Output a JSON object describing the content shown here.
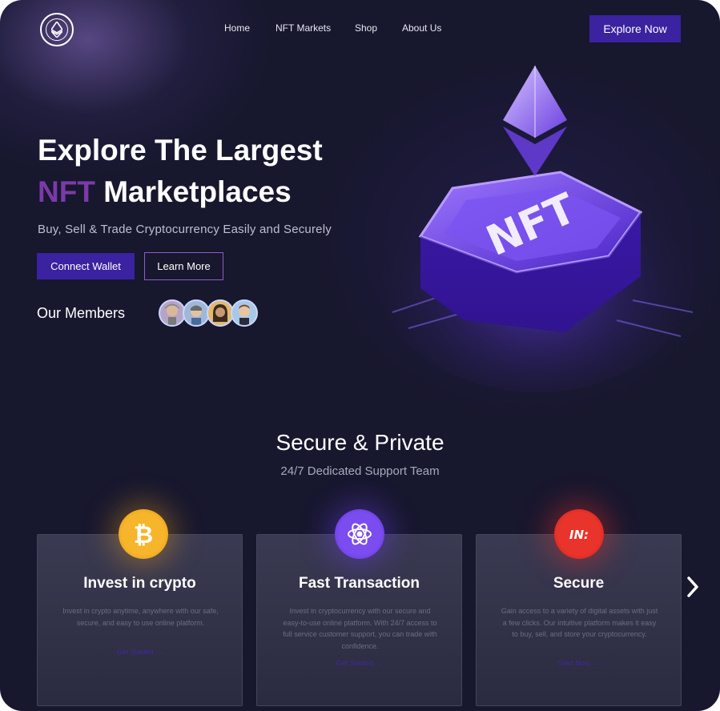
{
  "nav": {
    "logo_icon": "ethereum-icon",
    "links": [
      "Home",
      "NFT Markets",
      "Shop",
      "About Us"
    ],
    "cta": "Explore Now"
  },
  "hero": {
    "title_line1": "Explore The Largest",
    "title_accent": "NFT",
    "title_line2_rest": "Marketplaces",
    "subtitle": "Buy, Sell & Trade Cryptocurrency Easily and Securely",
    "connect_wallet": "Connect Wallet",
    "learn_more": "Learn More",
    "members_label": "Our Members",
    "art_text": "NFT"
  },
  "features": {
    "title": "Secure & Private",
    "subtitle": "24/7 Dedicated Support Team",
    "cards": [
      {
        "title": "Invest in crypto",
        "text": "Invest in crypto anytime, anywhere with our safe, secure, and easy to use online platform.",
        "link": "Get Started",
        "icon": "bitcoin-icon",
        "color": "#f2a21c"
      },
      {
        "title": "Fast Transaction",
        "text": "Invest in cryptocurrency with our secure and easy-to-use online platform. With 24/7 access to full service customer support, you can trade with confidence.",
        "link": "Get Started",
        "icon": "atom-icon",
        "color": "#6a3ee0"
      },
      {
        "title": "Secure",
        "text": "Gain access to a variety of digital assets with just a few clicks. Our intuitive platform makes it easy to buy, sell, and store your cryptocurrency.",
        "link": "Start Now",
        "icon": "shield-brand-icon",
        "color": "#e0322a"
      }
    ]
  },
  "colors": {
    "background": "#17172e",
    "accent": "#3a22a0",
    "accent_text": "#7b3aa8"
  }
}
